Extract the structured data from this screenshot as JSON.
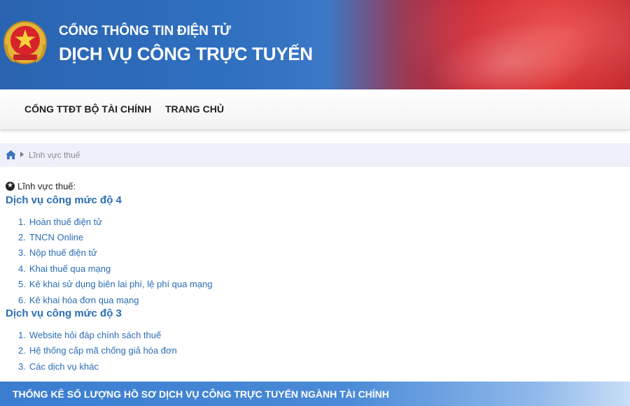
{
  "header": {
    "title_line1": "CỔNG THÔNG TIN ĐIỆN TỬ",
    "title_line2": "DỊCH VỤ CÔNG TRỰC TUYẾN",
    "emblem_icon": "national-emblem-icon"
  },
  "nav": {
    "items": [
      {
        "label": "CỔNG TTĐT BỘ TÀI CHÍNH"
      },
      {
        "label": "TRANG CHỦ"
      }
    ]
  },
  "breadcrumb": {
    "home_icon": "home-icon",
    "current": "Lĩnh vực thuế"
  },
  "content": {
    "field_label": "Lĩnh vực thuế:",
    "sections": [
      {
        "title": "Dịch vụ công mức độ 4",
        "items": [
          {
            "num": "1.",
            "label": "Hoàn thuế điện tử"
          },
          {
            "num": "2.",
            "label": "TNCN Online"
          },
          {
            "num": "3.",
            "label": "Nộp thuế điện tử"
          },
          {
            "num": "4.",
            "label": "Khai thuế qua mạng"
          },
          {
            "num": "5.",
            "label": "Kê khai sử dụng biên lai phí, lệ phí qua mạng"
          },
          {
            "num": "6.",
            "label": "Kê khai hóa đơn qua mạng"
          }
        ]
      },
      {
        "title": "Dịch vụ công mức độ 3",
        "items": [
          {
            "num": "1.",
            "label": "Website hỏi đáp chính sách thuế"
          },
          {
            "num": "2.",
            "label": "Hệ thống cấp mã chống giả hóa đơn"
          },
          {
            "num": "3.",
            "label": "Các dịch vụ khác"
          }
        ]
      }
    ]
  },
  "stats": {
    "title": "THỐNG KÊ SỐ LƯỢNG HỒ SƠ DỊCH VỤ CÔNG TRỰC TUYẾN NGÀNH TÀI CHÍNH"
  },
  "colors": {
    "link_blue": "#2a6db5",
    "header_blue": "#2f6fbf",
    "header_red": "#d52a2a"
  }
}
